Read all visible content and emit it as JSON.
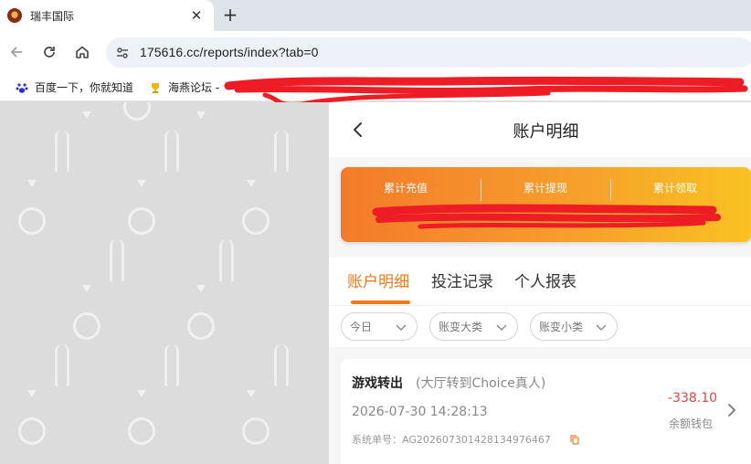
{
  "browser": {
    "tab_title": "瑞丰国际",
    "tab_close": "✕",
    "new_tab": "+",
    "url": "175616.cc/reports/index?tab=0",
    "bookmarks": [
      {
        "label": "百度一下，你就知道",
        "icon": "baidu-paw-icon"
      },
      {
        "label": "海燕论坛 -",
        "icon": "trophy-icon"
      }
    ]
  },
  "page": {
    "title": "账户明细",
    "summary": [
      {
        "label": "累计充值"
      },
      {
        "label": "累计提现"
      },
      {
        "label": "累计领取"
      }
    ],
    "tabs": [
      {
        "label": "账户明细",
        "active": true
      },
      {
        "label": "投注记录",
        "active": false
      },
      {
        "label": "个人报表",
        "active": false
      }
    ],
    "filters": [
      {
        "label": "今日"
      },
      {
        "label": "账变大类"
      },
      {
        "label": "账变小类"
      }
    ],
    "records": [
      {
        "title": "游戏转出",
        "subtitle": "(大厅转到Choice真人)",
        "time": "2026-07-30 14:28:13",
        "amount": "-338.10",
        "wallet": "余额钱包",
        "order": "系统单号：AG20260730142813497646​7"
      }
    ]
  },
  "colors": {
    "accent": "#f27a1a",
    "negative": "#e8453c",
    "redaction": "#ee1c25"
  }
}
